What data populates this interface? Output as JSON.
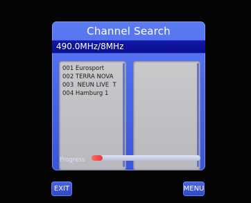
{
  "dialog": {
    "title": "Channel Search",
    "frequency": "490.0MHz/8MHz"
  },
  "channels": [
    "001 Eurosport",
    "002 TERRA NOVA",
    "003  NEUN LIVE  T",
    "004 Hamburg 1"
  ],
  "progress": {
    "label": "Progress",
    "value_fraction": 0.1
  },
  "softkeys": {
    "exit_label": "EXIT",
    "menu_label": "MENU"
  },
  "colors": {
    "panel": "#4a68e6",
    "freq_bar": "#0a0f8c",
    "list_bg": "#c1c1c4",
    "progress_fill": "#e33a3a",
    "softkey": "#3a55d6"
  }
}
